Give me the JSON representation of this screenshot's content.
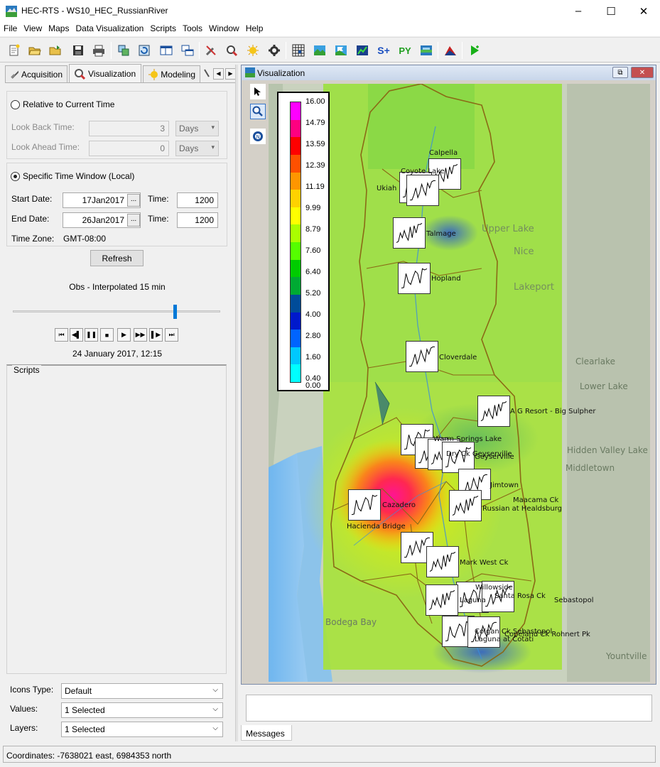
{
  "window": {
    "title": "HEC-RTS - WS10_HEC_RussianRiver",
    "controls": [
      "–",
      "☐",
      "✕"
    ]
  },
  "menu": [
    "File",
    "View",
    "Maps",
    "Data Visualization",
    "Scripts",
    "Tools",
    "Window",
    "Help"
  ],
  "toolbar": {
    "text_buttons": {
      "s_plus": "S+",
      "py": "PY"
    },
    "icons": [
      "new-icon",
      "open-icon",
      "open-folder-icon",
      "save-icon",
      "print-icon",
      "sync-icon",
      "refresh-icon",
      "layout-icon",
      "windows-icon",
      "tools-icon",
      "zoom-tool-icon",
      "weather-icon",
      "settings-icon",
      "grid-icon",
      "map-layer-icon",
      "flag-icon",
      "chart-icon",
      "script-icon",
      "python-icon",
      "globe-icon",
      "mountain-icon",
      "run-icon"
    ]
  },
  "tabs": [
    {
      "label": "Acquisition",
      "active": false
    },
    {
      "label": "Visualization",
      "active": true
    },
    {
      "label": "Modeling",
      "active": false
    }
  ],
  "time_window": {
    "relative_label": "Relative to Current Time",
    "relative_selected": false,
    "look_back_label": "Look Back Time:",
    "look_back_value": "3",
    "look_back_unit": "Days",
    "look_ahead_label": "Look Ahead Time:",
    "look_ahead_value": "0",
    "look_ahead_unit": "Days",
    "specific_label": "Specific Time Window (Local)",
    "specific_selected": true,
    "start_date_label": "Start Date:",
    "start_date": "17Jan2017",
    "start_time_label": "Time:",
    "start_time": "1200",
    "end_date_label": "End Date:",
    "end_date": "26Jan2017",
    "end_time_label": "Time:",
    "end_time": "1200",
    "time_zone_label": "Time Zone:",
    "time_zone": "GMT-08:00",
    "refresh_label": "Refresh",
    "ellipsis": "..."
  },
  "animation": {
    "dataset_label": "Obs - Interpolated 15 min",
    "slider_fraction": 0.78,
    "current_time": "24 January 2017, 12:15",
    "controls": [
      "first-icon",
      "step-back-icon",
      "pause-icon",
      "stop-icon",
      "play-icon",
      "fast-forward-icon",
      "step-forward-icon",
      "last-icon"
    ]
  },
  "scripts": {
    "label": "Scripts"
  },
  "options": {
    "icons_type_label": "Icons Type:",
    "icons_type_value": "Default",
    "values_label": "Values:",
    "values_value": "1 Selected",
    "layers_label": "Layers:",
    "layers_value": "1 Selected"
  },
  "visualization": {
    "title": "Visualization",
    "legend": {
      "labels": [
        "16.00",
        "14.79",
        "13.59",
        "12.39",
        "11.19",
        "9.99",
        "8.79",
        "7.60",
        "6.40",
        "5.20",
        "4.00",
        "2.80",
        "1.60",
        "0.40",
        "0.00"
      ],
      "colors": [
        "#ff00ff",
        "#ff0080",
        "#ff0000",
        "#ff5000",
        "#ff9600",
        "#ffd200",
        "#ffff00",
        "#aaff00",
        "#55ff00",
        "#00cc00",
        "#00aa33",
        "#004c99",
        "#0019cc",
        "#0064ff",
        "#00c8ff",
        "#00ffff"
      ]
    },
    "gauges": [
      "Calpella",
      "Coyote Lake",
      "Ukiah",
      "Talmage",
      "Hopland",
      "Cloverdale",
      "A G Resort - Big Sulpher",
      "Warm Springs Lake",
      "Dry Ck Geyserville",
      "Geyserville",
      "Jimtown",
      "Maacama Ck",
      "Russian at Healdsburg",
      "Cazadero",
      "Hacienda Bridge",
      "Mark West Ck",
      "Willowside",
      "Santa Rosa Ck",
      "Laguna",
      "Sebastopol",
      "Colgan Ck Sebastopol",
      "Laguna at Cotati",
      "Copeland Ck Rohnert Pk"
    ],
    "map_labels": [
      "Upper Lake",
      "Nice",
      "Lakeport",
      "Clearlake",
      "Lower Lake",
      "Hidden Valley Lake",
      "Middletown",
      "Bodega Bay",
      "Yountville"
    ]
  },
  "messages": {
    "tab_label": "Messages"
  },
  "status": {
    "coordinates": "Coordinates: -7638021 east, 6984353 north"
  }
}
